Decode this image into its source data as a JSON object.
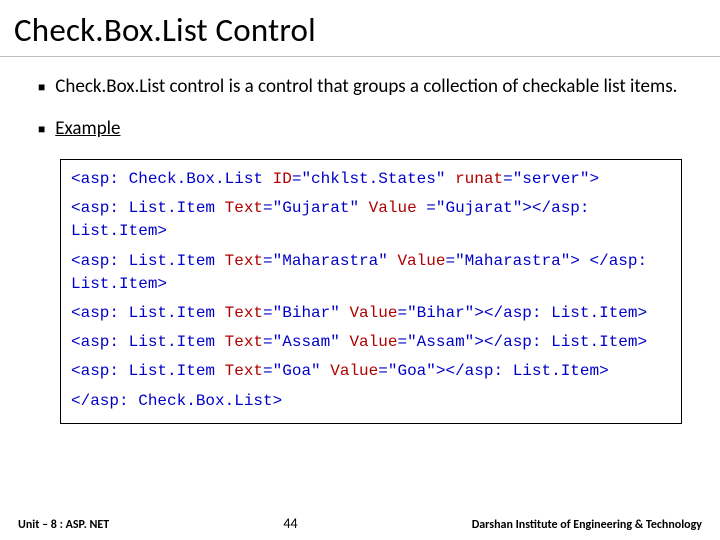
{
  "title": "Check.Box.List Control",
  "bullets": {
    "b1": "Check.Box.List control is a control that groups a collection of checkable list items.",
    "b2": "Example"
  },
  "code": {
    "l1a": "<asp: Check.Box.List ",
    "l1b": "ID",
    "l1c": "=\"chklst.States\" ",
    "l1d": "runat",
    "l1e": "=\"server\">",
    "l2a": "<asp: List.Item ",
    "l2b": "Text",
    "l2c": "=\"Gujarat\" ",
    "l2d": "Value",
    "l2e": " =\"Gujarat\"></asp: List.Item>",
    "l3a": "<asp: List.Item ",
    "l3b": "Text",
    "l3c": "=\"Maharastra\" ",
    "l3d": "Value",
    "l3e": "=\"Maharastra\"> </asp: List.Item>",
    "l4a": "<asp: List.Item ",
    "l4b": "Text",
    "l4c": "=\"Bihar\" ",
    "l4d": "Value",
    "l4e": "=\"Bihar\"></asp: List.Item>",
    "l5a": "<asp: List.Item ",
    "l5b": "Text",
    "l5c": "=\"Assam\" ",
    "l5d": "Value",
    "l5e": "=\"Assam\"></asp: List.Item>",
    "l6a": "<asp: List.Item ",
    "l6b": "Text",
    "l6c": "=\"Goa\" ",
    "l6d": "Value",
    "l6e": "=\"Goa\"></asp: List.Item>",
    "l7": "</asp: Check.Box.List>"
  },
  "footer": {
    "left": "Unit – 8 : ASP. NET",
    "page": "44",
    "right": "Darshan Institute of Engineering & Technology"
  }
}
